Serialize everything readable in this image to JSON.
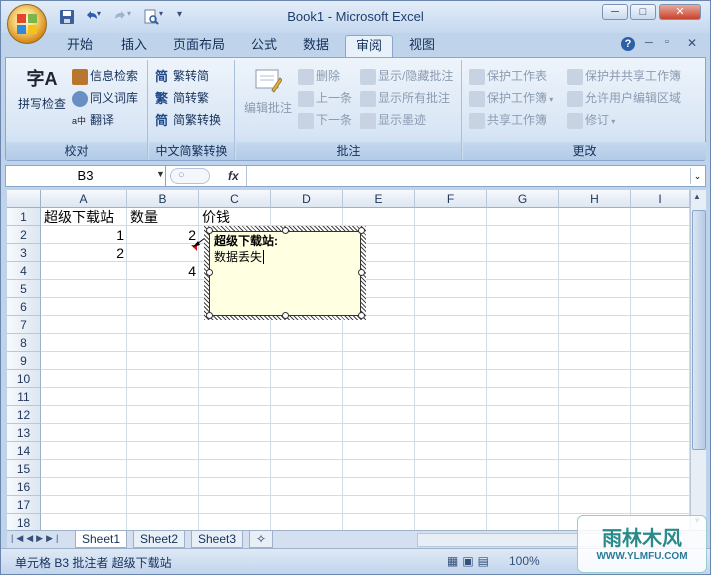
{
  "window": {
    "title": "Book1 - Microsoft Excel"
  },
  "quick_access": [
    "save-icon",
    "undo-icon",
    "redo-icon",
    "print-preview-icon"
  ],
  "tabs": [
    "开始",
    "插入",
    "页面布局",
    "公式",
    "数据",
    "审阅",
    "视图"
  ],
  "active_tab": "审阅",
  "ribbon": {
    "proofing": {
      "label": "校对",
      "spellcheck": "拼写检查",
      "research": "信息检索",
      "thesaurus": "同义词库",
      "translate": "翻译"
    },
    "chinese": {
      "label": "中文简繁转换",
      "to_simplified": "繁转简",
      "to_traditional": "简转繁",
      "convert": "简繁转换"
    },
    "comments": {
      "label": "批注",
      "edit": "编辑批注",
      "delete": "删除",
      "prev": "上一条",
      "next": "下一条",
      "show_hide": "显示/隐藏批注",
      "show_all": "显示所有批注",
      "show_ink": "显示墨迹"
    },
    "changes": {
      "label": "更改",
      "protect_sheet": "保护工作表",
      "protect_workbook": "保护工作簿",
      "share_workbook": "共享工作簿",
      "protect_share": "保护并共享工作簿",
      "allow_edit": "允许用户编辑区域",
      "track": "修订"
    }
  },
  "formula_bar": {
    "name_box": "B3",
    "fx": "fx",
    "value": ""
  },
  "columns": [
    "A",
    "B",
    "C",
    "D",
    "E",
    "F",
    "G",
    "H",
    "I"
  ],
  "rows": [
    "1",
    "2",
    "3",
    "4",
    "5",
    "6",
    "7",
    "8",
    "9",
    "10",
    "11",
    "12",
    "13",
    "14",
    "15",
    "16",
    "17",
    "18"
  ],
  "cells": {
    "A1": "超级下载站",
    "B1": "数量",
    "C1": "价钱",
    "A2": "1",
    "B2": "2",
    "A3": "2",
    "B4": "4"
  },
  "comment": {
    "author": "超级下载站:",
    "text": "数据丢失"
  },
  "sheets": [
    "Sheet1",
    "Sheet2",
    "Sheet3"
  ],
  "active_sheet": "Sheet1",
  "status": {
    "text": "单元格 B3 批注者 超级下载站",
    "zoom": "100%"
  },
  "watermark": {
    "brand": "雨林木风",
    "url": "WWW.YLMFU.COM"
  },
  "colors": {
    "accent": "#15315a",
    "comment_bg": "#ffffe1",
    "ribbon_bg": "#dbe7f5"
  }
}
